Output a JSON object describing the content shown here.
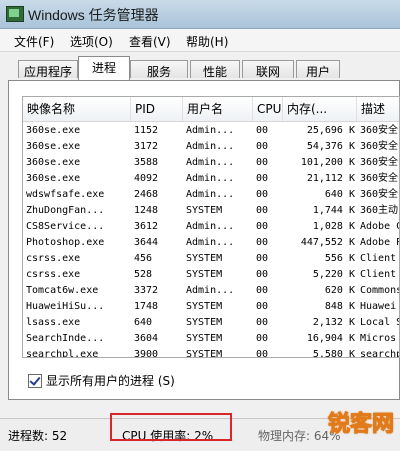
{
  "window": {
    "title": "Windows 任务管理器"
  },
  "menu": [
    {
      "label": "文件(F)"
    },
    {
      "label": "选项(O)"
    },
    {
      "label": "查看(V)"
    },
    {
      "label": "帮助(H)"
    }
  ],
  "tabs": [
    {
      "label": "应用程序",
      "active": false
    },
    {
      "label": "进程",
      "active": true
    },
    {
      "label": "服务",
      "active": false
    },
    {
      "label": "性能",
      "active": false
    },
    {
      "label": "联网",
      "active": false
    },
    {
      "label": "用户",
      "active": false
    }
  ],
  "columns": [
    {
      "label": "映像名称"
    },
    {
      "label": "PID"
    },
    {
      "label": "用户名"
    },
    {
      "label": "CPU"
    },
    {
      "label": "内存(..."
    },
    {
      "label": "描述"
    }
  ],
  "rows": [
    [
      "360se.exe",
      "1152",
      "Admin...",
      "00",
      "25,696 K",
      "360安全"
    ],
    [
      "360se.exe",
      "3172",
      "Admin...",
      "00",
      "54,376 K",
      "360安全"
    ],
    [
      "360se.exe",
      "3588",
      "Admin...",
      "00",
      "101,200 K",
      "360安全"
    ],
    [
      "360se.exe",
      "4092",
      "Admin...",
      "00",
      "21,112 K",
      "360安全"
    ],
    [
      "wdswfsafe.exe",
      "2468",
      "Admin...",
      "00",
      "640 K",
      "360安全"
    ],
    [
      "ZhuDongFan...",
      "1248",
      "SYSTEM",
      "00",
      "1,744 K",
      "360主动"
    ],
    [
      "CS8Service...",
      "3612",
      "Admin...",
      "00",
      "1,028 K",
      "Adobe C"
    ],
    [
      "Photoshop.exe",
      "3644",
      "Admin...",
      "00",
      "447,552 K",
      "Adobe P"
    ],
    [
      "csrss.exe",
      "456",
      "SYSTEM",
      "00",
      "556 K",
      "Client"
    ],
    [
      "csrss.exe",
      "528",
      "SYSTEM",
      "00",
      "5,220 K",
      "Client"
    ],
    [
      "Tomcat6w.exe",
      "3372",
      "Admin...",
      "00",
      "620 K",
      "Commons"
    ],
    [
      "HuaweiHiSu...",
      "1748",
      "SYSTEM",
      "00",
      "848 K",
      "Huawei"
    ],
    [
      "lsass.exe",
      "640",
      "SYSTEM",
      "00",
      "2,132 K",
      "Local S"
    ],
    [
      "SearchInde...",
      "3604",
      "SYSTEM",
      "00",
      "16,904 K",
      "Micros"
    ],
    [
      "searchpl.exe",
      "3900",
      "SYSTEM",
      "00",
      "5,580 K",
      "searchp"
    ]
  ],
  "show_all_users": {
    "label": "显示所有用户的进程 (S)",
    "checked": true
  },
  "status": {
    "processes": "进程数: 52",
    "cpu": "CPU 使用率: 2%",
    "memory": "物理内存: 64%"
  },
  "watermark": "锐客网",
  "colors": {
    "highlight_box": "#d8262d",
    "watermark": "#e07a1a"
  }
}
